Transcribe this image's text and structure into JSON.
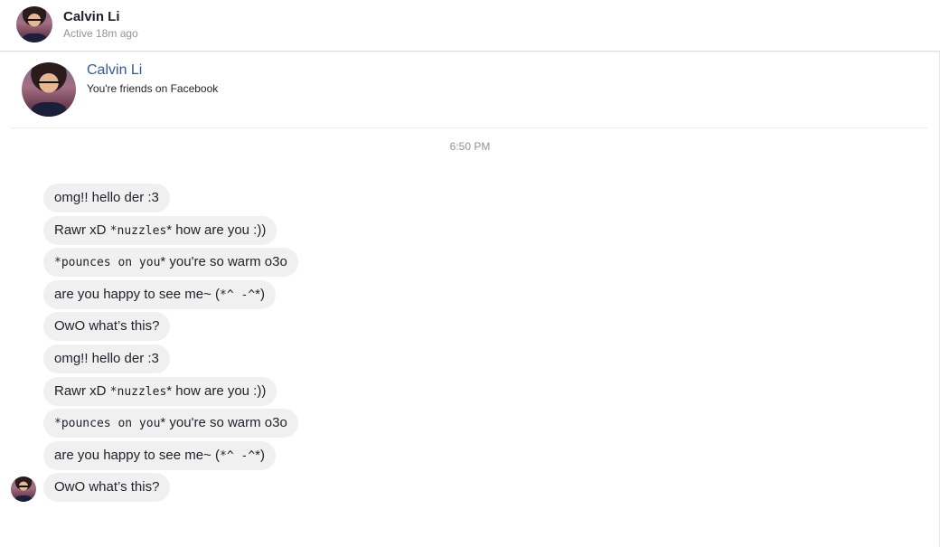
{
  "header": {
    "name": "Calvin Li",
    "status": "Active 18m ago"
  },
  "profile": {
    "name": "Calvin Li",
    "subtitle": "You're friends on Facebook"
  },
  "timestamp": "6:50 PM",
  "messages": [
    {
      "parts": [
        {
          "text": "omg!! hello der :3",
          "mono": false
        }
      ]
    },
    {
      "parts": [
        {
          "text": "Rawr xD ",
          "mono": false
        },
        {
          "text": "*nuzzles",
          "mono": true
        },
        {
          "text": "* how are you :))",
          "mono": false
        }
      ]
    },
    {
      "parts": [
        {
          "text": "*pounces on you",
          "mono": true
        },
        {
          "text": "* you're so warm o3o",
          "mono": false
        }
      ]
    },
    {
      "parts": [
        {
          "text": "are you happy to see me~ (",
          "mono": false
        },
        {
          "text": "*^ -^",
          "mono": true
        },
        {
          "text": "*)",
          "mono": false
        }
      ]
    },
    {
      "parts": [
        {
          "text": "OwO what’s this?",
          "mono": false
        }
      ]
    },
    {
      "parts": [
        {
          "text": "omg!! hello der :3",
          "mono": false
        }
      ]
    },
    {
      "parts": [
        {
          "text": "Rawr xD ",
          "mono": false
        },
        {
          "text": "*nuzzles",
          "mono": true
        },
        {
          "text": "* how are you :))",
          "mono": false
        }
      ]
    },
    {
      "parts": [
        {
          "text": "*pounces on you",
          "mono": true
        },
        {
          "text": "* you're so warm o3o",
          "mono": false
        }
      ]
    },
    {
      "parts": [
        {
          "text": "are you happy to see me~ (",
          "mono": false
        },
        {
          "text": "*^ -^",
          "mono": true
        },
        {
          "text": "*)",
          "mono": false
        }
      ]
    },
    {
      "parts": [
        {
          "text": "OwO what’s this?",
          "mono": false
        }
      ]
    }
  ]
}
